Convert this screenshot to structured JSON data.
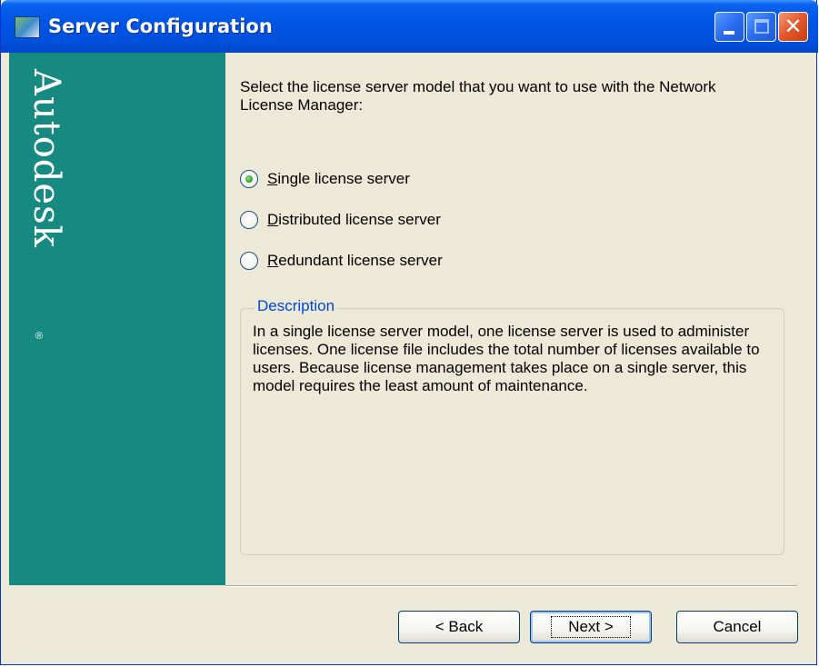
{
  "window": {
    "title": "Server Configuration"
  },
  "titlebar": {
    "icon": "app-icon",
    "minimize_icon": "minimize-icon",
    "maximize_icon": "maximize-icon",
    "close_icon": "close-icon",
    "close_glyph": "✕"
  },
  "sidebar": {
    "brand": "Autodesk",
    "brand_mark": "®",
    "color": "#168a80"
  },
  "main": {
    "prompt": "Select the license server model that you want to use with the Network License Manager:",
    "options": [
      {
        "label": "Single license server",
        "checked": true
      },
      {
        "label": "Distributed license server",
        "checked": false
      },
      {
        "label": "Redundant license server",
        "checked": false
      }
    ],
    "description_title": "Description",
    "description_text": "In a single license server model, one license server is used to administer licenses.  One license file includes the total number of licenses available to users.  Because license management takes place on a single server, this model requires the least amount of maintenance."
  },
  "footer": {
    "back_label": "< Back",
    "next_label": "Next >",
    "cancel_label": "Cancel"
  },
  "colors": {
    "titlebar": "#0055e5",
    "dialog_bg": "#ece9d8",
    "legend": "#0046d5",
    "close_button": "#e2562c"
  }
}
